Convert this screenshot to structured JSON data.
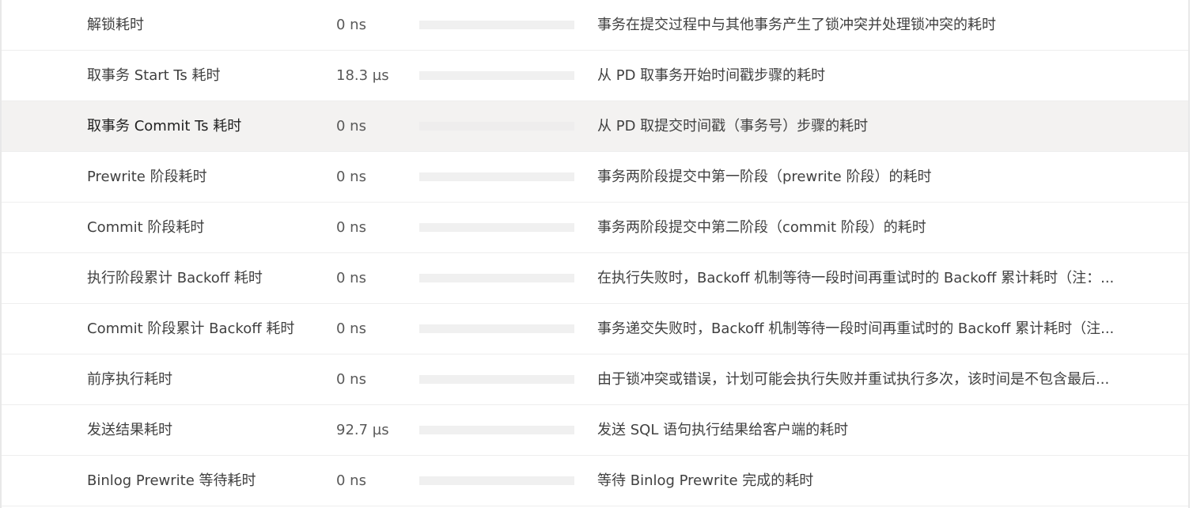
{
  "rows": [
    {
      "name": "解锁耗时",
      "value": "0 ns",
      "fraction": 0,
      "desc": "事务在提交过程中与其他事务产生了锁冲突并处理锁冲突的耗时"
    },
    {
      "name": "取事务 Start Ts 耗时",
      "value": "18.3 µs",
      "fraction": 0,
      "desc": "从 PD 取事务开始时间戳步骤的耗时"
    },
    {
      "name": "取事务 Commit Ts 耗时",
      "value": "0 ns",
      "fraction": 0,
      "desc": "从 PD 取提交时间戳（事务号）步骤的耗时",
      "selected": true
    },
    {
      "name": "Prewrite 阶段耗时",
      "value": "0 ns",
      "fraction": 0,
      "desc": "事务两阶段提交中第一阶段（prewrite 阶段）的耗时"
    },
    {
      "name": "Commit 阶段耗时",
      "value": "0 ns",
      "fraction": 0,
      "desc": "事务两阶段提交中第二阶段（commit 阶段）的耗时"
    },
    {
      "name": "执行阶段累计 Backoff 耗时",
      "value": "0 ns",
      "fraction": 0,
      "desc": "在执行失败时，Backoff 机制等待一段时间再重试时的 Backoff 累计耗时（注：..."
    },
    {
      "name": "Commit 阶段累计 Backoff 耗时",
      "value": "0 ns",
      "fraction": 0,
      "desc": "事务递交失败时，Backoff 机制等待一段时间再重试时的 Backoff 累计耗时（注..."
    },
    {
      "name": "前序执行耗时",
      "value": "0 ns",
      "fraction": 0,
      "desc": "由于锁冲突或错误，计划可能会执行失败并重试执行多次，该时间是不包含最后..."
    },
    {
      "name": "发送结果耗时",
      "value": "92.7 µs",
      "fraction": 0,
      "desc": "发送 SQL 语句执行结果给客户端的耗时"
    },
    {
      "name": "Binlog Prewrite 等待耗时",
      "value": "0 ns",
      "fraction": 0,
      "desc": "等待 Binlog Prewrite 完成的耗时"
    }
  ],
  "colors": {
    "bar_track": "#f0f0f0",
    "bar_fill": "#1890ff",
    "selected_row": "#f3f2f1"
  }
}
